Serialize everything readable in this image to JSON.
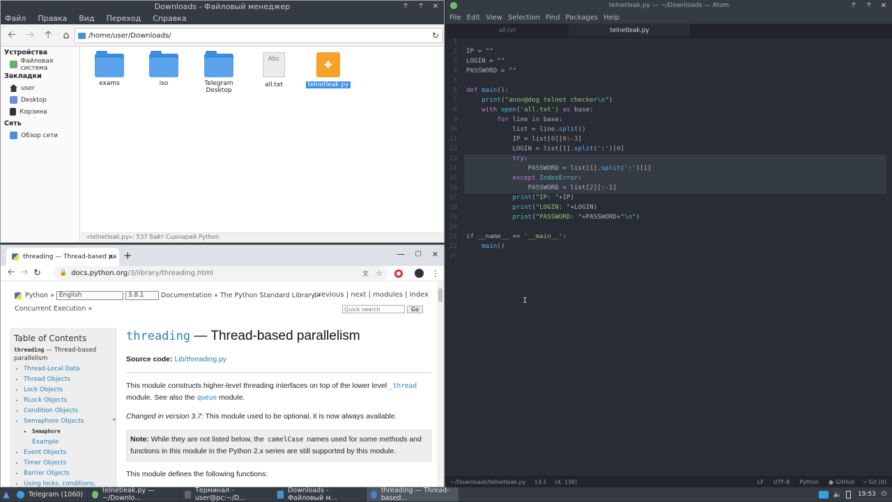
{
  "file_manager": {
    "title": "Downloads - Файловый менеджер",
    "menu": [
      "Файл",
      "Правка",
      "Вид",
      "Переход",
      "Справка"
    ],
    "path": "/home/user/Downloads/",
    "sidebar": {
      "devices_header": "Устройства",
      "devices": [
        "Файловая система"
      ],
      "bookmarks_header": "Закладки",
      "bookmarks": [
        "user",
        "Desktop",
        "Корзина"
      ],
      "network_header": "Сеть",
      "network": [
        "Обзор сети"
      ]
    },
    "files": [
      {
        "name": "exams",
        "type": "folder"
      },
      {
        "name": "iso",
        "type": "folder"
      },
      {
        "name": "Telegram Desktop",
        "type": "folder"
      },
      {
        "name": "all.txt",
        "type": "text",
        "badge": "Abc"
      },
      {
        "name": "telnetleak.py",
        "type": "python",
        "selected": true
      }
    ],
    "status": "«telnetleak.py»: 537 байт Сценарий Python"
  },
  "browser": {
    "tab_title": "threading — Thread-based pa",
    "url_host": "docs.python.org",
    "url_path": "/3/library/threading.html",
    "rel": {
      "python": "Python",
      "lang": "English",
      "version": "3.8.1",
      "crumbs": "Documentation » The Python Standard Library »",
      "crumb2": "Concurrent Execution »"
    },
    "nav": {
      "previous": "previous",
      "next": "next",
      "modules": "modules",
      "index": "index",
      "search_placeholder": "Quick search",
      "go": "Go"
    },
    "toc": {
      "title": "Table of Contents",
      "mod": "threading",
      "mod_rest": " — Thread-based parallelism",
      "items": [
        "Thread-Local Data",
        "Thread Objects",
        "Lock Objects",
        "RLock Objects",
        "Condition Objects",
        "Semaphore Objects"
      ],
      "sub": "Semaphore",
      "sub2": "Example",
      "items2": [
        "Event Objects",
        "Timer Objects",
        "Barrier Objects",
        "Using locks, conditions,"
      ]
    },
    "content": {
      "title_mono": "threading",
      "title_rest": " — Thread-based parallelism",
      "source_label": "Source code:",
      "source_link": "Lib/threading.py",
      "p1a": "This module constructs higher-level threading interfaces on top of the lower level ",
      "p1code": "_thread",
      "p1b": " module. See also the ",
      "p1code2": "queue",
      "p1c": " module.",
      "changed_em": "Changed in version 3.7:",
      "changed_rest": " This module used to be optional, it is now always available.",
      "note_label": "Note:",
      "note_a": " While they are not listed below, the ",
      "note_code": "camelCase",
      "note_b": " names used for some methods and functions in this module in the Python 2.x series are still supported by this module.",
      "p3": "This module defines the following functions:"
    }
  },
  "atom": {
    "title": "telnetleak.py — ~/Downloads — Atom",
    "menu": [
      "File",
      "Edit",
      "View",
      "Selection",
      "Find",
      "Packages",
      "Help"
    ],
    "tabs": [
      "all.txt",
      "telnetleak.py"
    ],
    "status": {
      "path": "~/Downloads/telnetleak.py",
      "cursor": "13:1",
      "selection": "(4, 136)",
      "eol": "LF",
      "encoding": "UTF-8",
      "grammar": "Python",
      "github": "GitHub",
      "git": "Git (0)"
    }
  },
  "taskbar": {
    "items": [
      "Telegram (1060)",
      "telnetleak.py — ~/Downlo...",
      "Терминал - user@pc:~/D...",
      "Downloads - Файловый м...",
      "threading — Thread-based..."
    ],
    "clock": "19:53"
  }
}
